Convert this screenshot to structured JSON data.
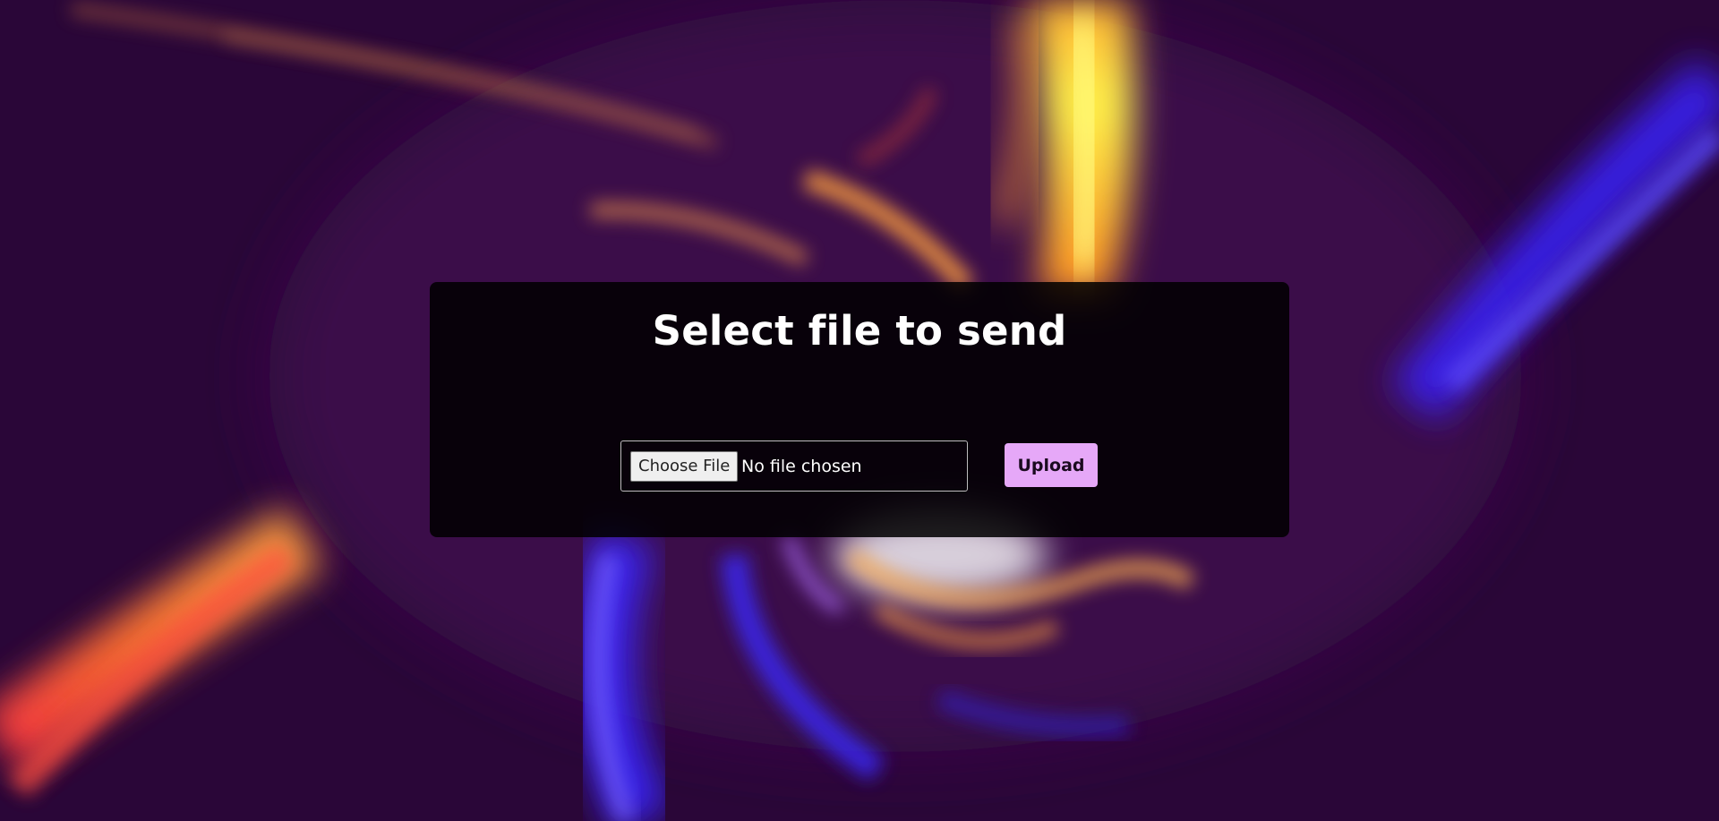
{
  "page": {
    "title": "Select file to send"
  },
  "file_input": {
    "button_label": "Choose File",
    "status_text": "No file chosen"
  },
  "upload_button": {
    "label": "Upload"
  },
  "colors": {
    "background": "#2a0638",
    "panel": "rgba(0,0,0,0.86)",
    "upload_button_bg": "#e6a8f8",
    "title_text": "#ffffff"
  },
  "icons": {
    "background": "swirl-vortex-background"
  }
}
